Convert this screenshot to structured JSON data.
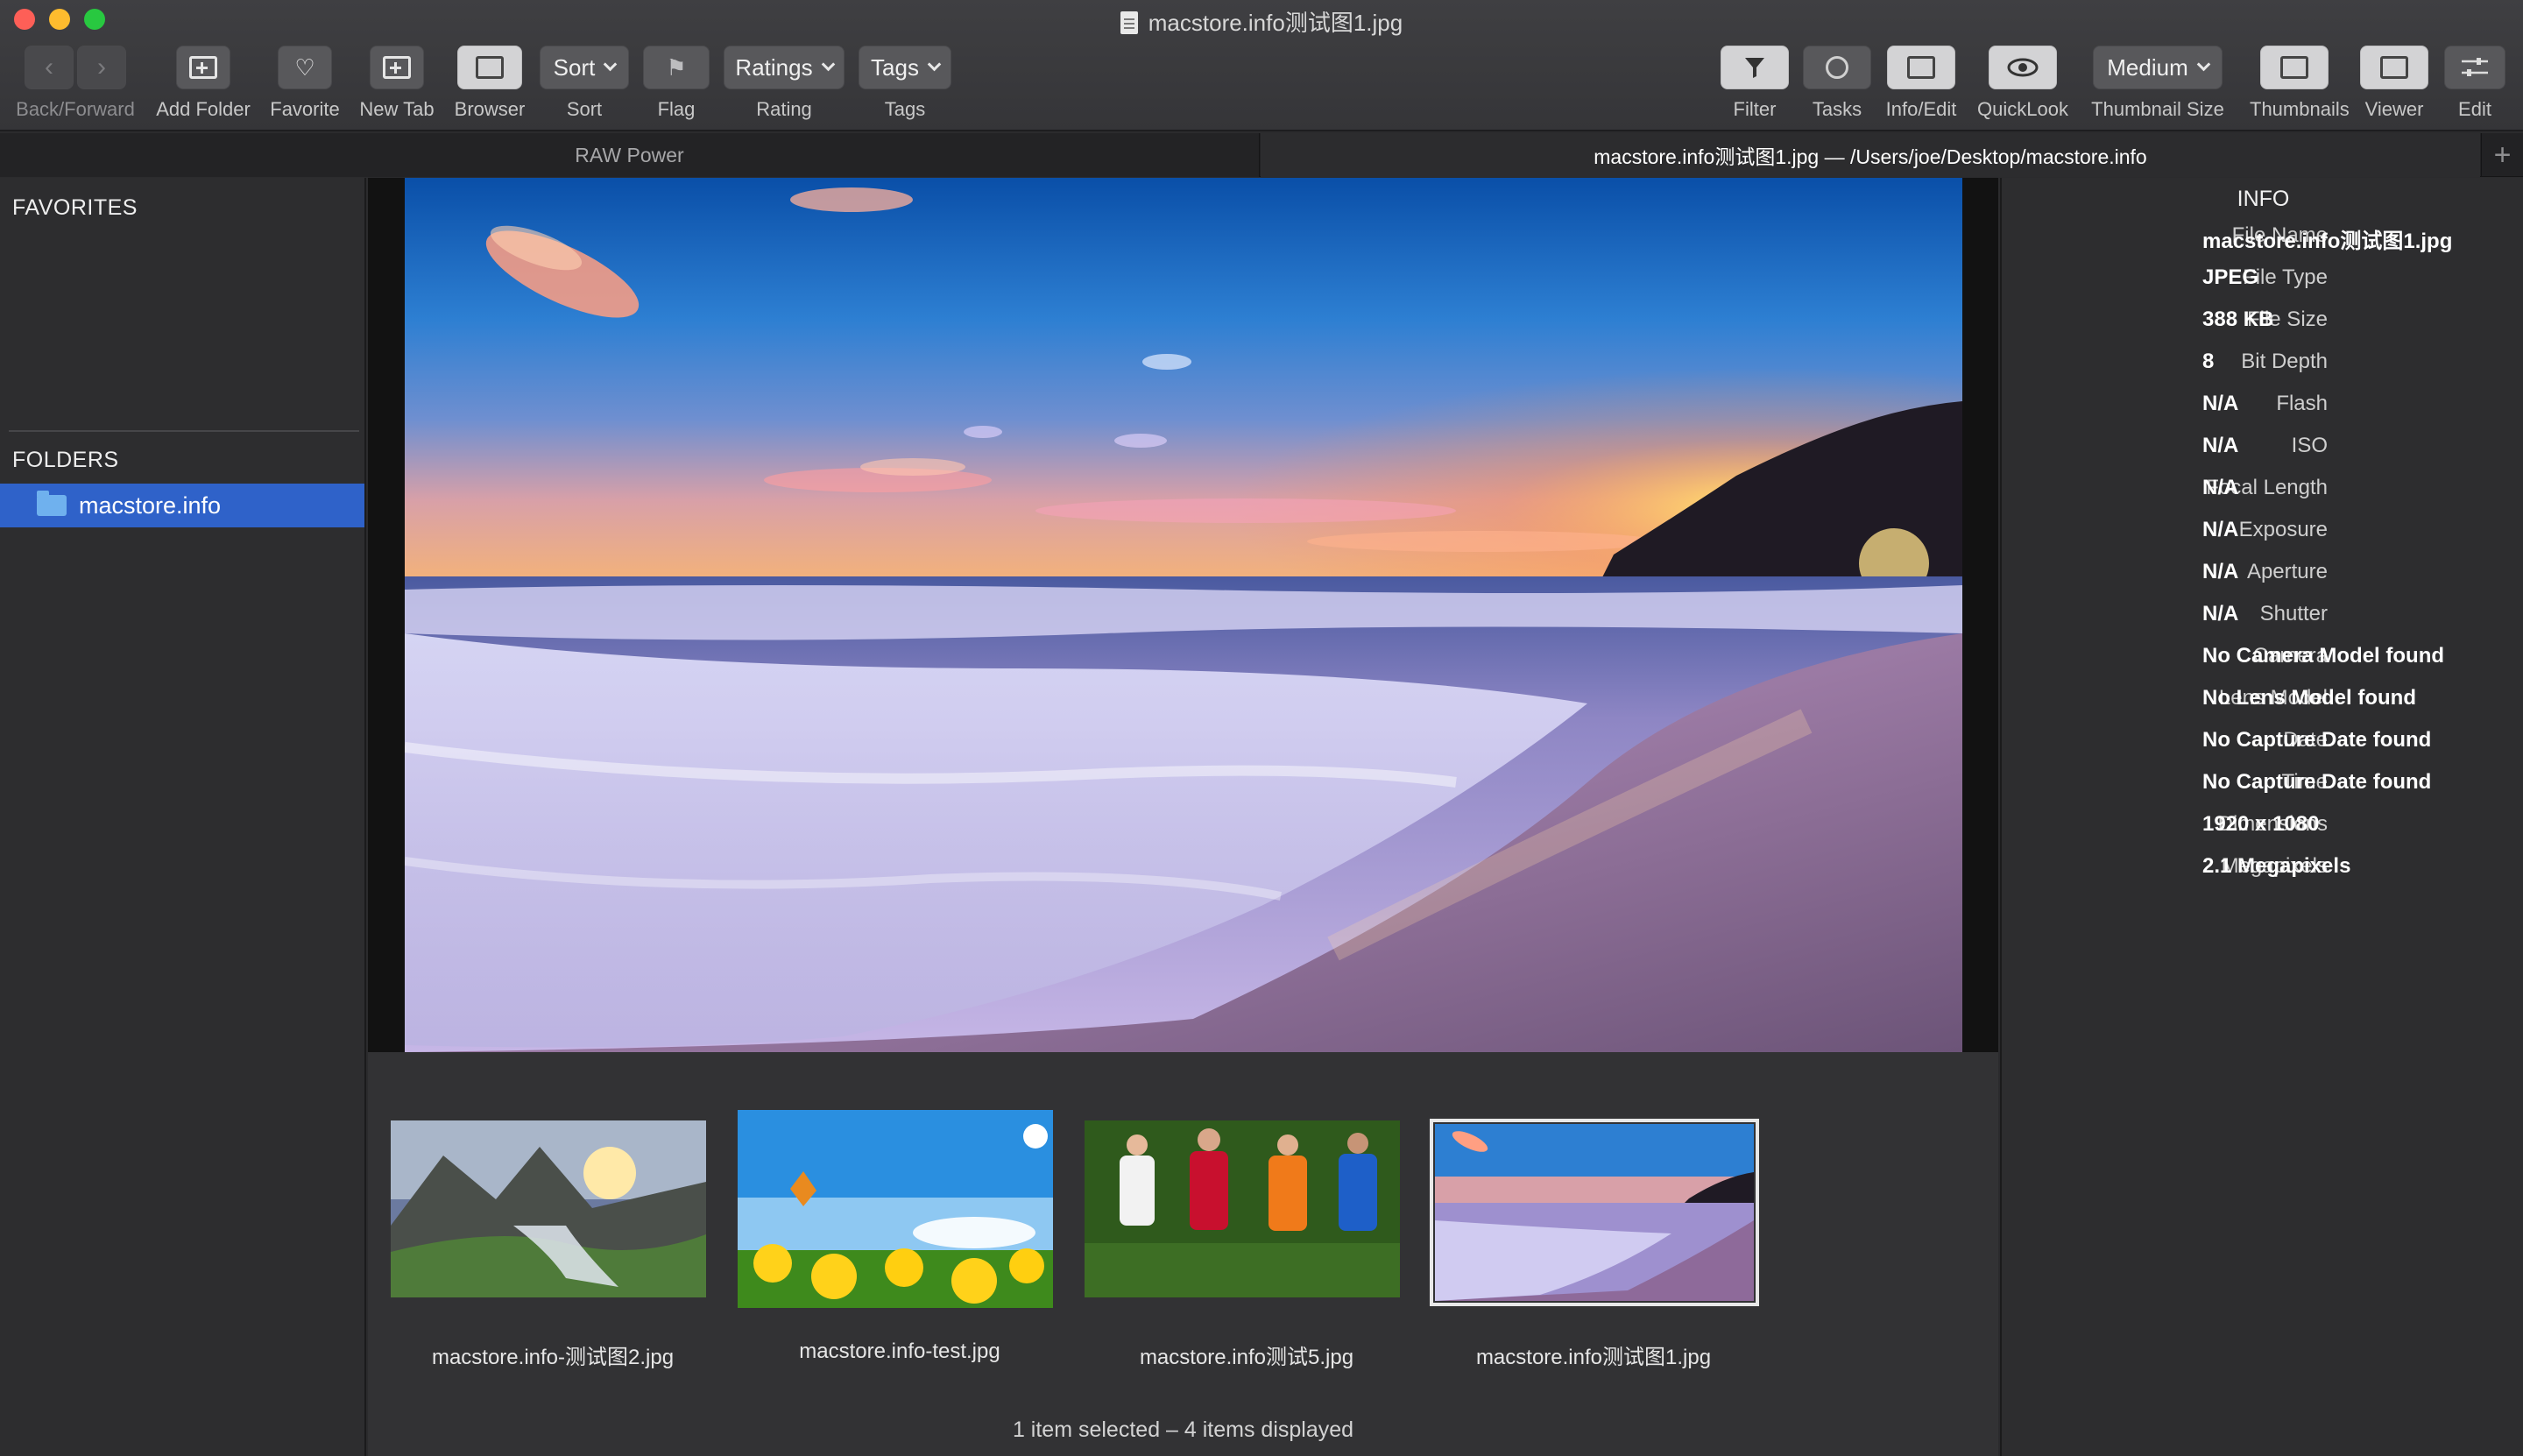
{
  "window": {
    "title": "macstore.info测试图1.jpg",
    "traffic_colors": {
      "close": "#fe5f57",
      "minimize": "#febc2e",
      "zoom": "#28c840"
    }
  },
  "toolbar": {
    "left": [
      {
        "label": "Back/Forward",
        "icon": "back-forward-arrows"
      },
      {
        "label": "Add Folder",
        "icon": "add-folder-icon"
      },
      {
        "label": "Favorite",
        "icon": "heart-folder-icon"
      },
      {
        "label": "New Tab",
        "icon": "new-tab-icon"
      },
      {
        "label": "Browser",
        "icon": "browser-layout-icon"
      },
      {
        "label": "Sort",
        "button": "Sort"
      },
      {
        "label": "Flag",
        "icon": "flag-icon"
      },
      {
        "label": "Rating",
        "button": "Ratings"
      },
      {
        "label": "Tags",
        "button": "Tags"
      }
    ],
    "right": [
      {
        "label": "Filter",
        "icon": "filter-funnel-icon"
      },
      {
        "label": "Tasks",
        "icon": "tasks-circle-icon"
      },
      {
        "label": "Info/Edit",
        "icon": "info-edit-layout-icon"
      },
      {
        "label": "QuickLook",
        "icon": "eye-icon"
      },
      {
        "label": "Thumbnail Size",
        "button": "Medium"
      },
      {
        "label": "Thumbnails",
        "icon": "thumbnails-layout-icon"
      },
      {
        "label": "Viewer",
        "icon": "viewer-layout-icon"
      },
      {
        "label": "Edit",
        "icon": "sliders-icon"
      }
    ]
  },
  "tabs": {
    "inactive": "RAW Power",
    "active": "macstore.info测试图1.jpg  —  /Users/joe/Desktop/macstore.info",
    "add": "+"
  },
  "sidebar": {
    "favorites_heading": "FAVORITES",
    "folders_heading": "FOLDERS",
    "folders": [
      {
        "name": "macstore.info",
        "selected": true
      }
    ],
    "selection_color": "#2f62c9"
  },
  "browser": {
    "thumbnails": [
      {
        "name": "macstore.info-测试图2.jpg",
        "scene": "mountain-waterfall-sunset",
        "selected": false
      },
      {
        "name": "macstore.info-test.jpg",
        "scene": "flowers-butterfly",
        "selected": false
      },
      {
        "name": "macstore.info测试5.jpg",
        "scene": "soccer-players",
        "selected": false
      },
      {
        "name": "macstore.info测试图1.jpg",
        "scene": "beach-sunset",
        "selected": true
      }
    ],
    "status": "1 item selected – 4 items displayed"
  },
  "info_panel": {
    "title": "INFO",
    "rows": [
      {
        "key": "File Name",
        "value": "macstore.info测试图1.jpg"
      },
      {
        "key": "File Type",
        "value": "JPEG"
      },
      {
        "key": "File Size",
        "value": "388 KB"
      },
      {
        "key": "Bit Depth",
        "value": "8"
      },
      {
        "key": "Flash",
        "value": "N/A"
      },
      {
        "key": "ISO",
        "value": "N/A"
      },
      {
        "key": "Focal Length",
        "value": "N/A"
      },
      {
        "key": "Exposure",
        "value": "N/A"
      },
      {
        "key": "Aperture",
        "value": "N/A"
      },
      {
        "key": "Shutter",
        "value": "N/A"
      },
      {
        "key": "Camera",
        "value": "No Camera Model found"
      },
      {
        "key": "Lens Model",
        "value": "No Lens Model found"
      },
      {
        "key": "Date",
        "value": "No Capture Date found"
      },
      {
        "key": "Time",
        "value": "No Capture Date found"
      },
      {
        "key": "Dimensions",
        "value": "1920 x 1080"
      },
      {
        "key": "Megapixels",
        "value": "2.1 Megapixels"
      }
    ]
  }
}
